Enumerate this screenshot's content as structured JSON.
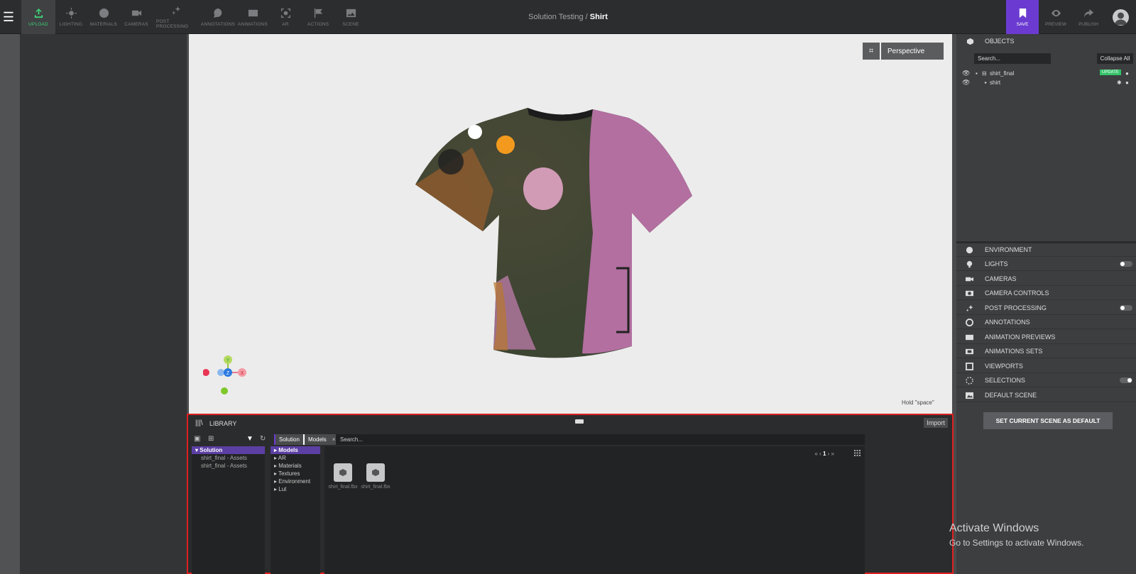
{
  "toolbar": {
    "tools": [
      {
        "label": "UPLOAD",
        "icon": "upload-icon",
        "active": true
      },
      {
        "label": "LIGHTING",
        "icon": "sun-icon"
      },
      {
        "label": "MATERIALS",
        "icon": "materials-icon"
      },
      {
        "label": "CAMERAS",
        "icon": "camera-icon"
      },
      {
        "label": "POST PROCESSING",
        "icon": "sparkle-icon"
      },
      {
        "label": "ANNOTATIONS",
        "icon": "chat-icon"
      },
      {
        "label": "ANIMATIONS",
        "icon": "film-icon"
      },
      {
        "label": "AR",
        "icon": "ar-icon"
      },
      {
        "label": "ACTIONS",
        "icon": "flag-icon"
      },
      {
        "label": "SCENE",
        "icon": "image-icon"
      }
    ],
    "right": [
      {
        "label": "SAVE",
        "icon": "bookmark-icon",
        "active": true
      },
      {
        "label": "PREVIEW",
        "icon": "eye-icon"
      },
      {
        "label": "PUBLISH",
        "icon": "share-icon"
      }
    ]
  },
  "breadcrumb": {
    "project": "Solution Testing",
    "separator": "/",
    "scene": "Shirt"
  },
  "viewport": {
    "camera_mode": "Perspective",
    "hint": "Hold \"space\"",
    "gizmo": {
      "y": "Y",
      "z": "Z",
      "x": "X"
    }
  },
  "library": {
    "title": "LIBRARY",
    "import_label": "Import",
    "tabs": [
      "Solution",
      "Models"
    ],
    "tab_close": "×",
    "search_placeholder": "Search...",
    "tree": {
      "root": "Solution",
      "children": [
        "shirt_final - Assets",
        "shirt_final - Assets"
      ]
    },
    "categories": [
      {
        "label": "Models",
        "selected": true
      },
      {
        "label": "AR"
      },
      {
        "label": "Materials"
      },
      {
        "label": "Textures"
      },
      {
        "label": "Environment"
      },
      {
        "label": "Lut"
      }
    ],
    "pager": {
      "first": "«",
      "prev": "‹",
      "page": "1",
      "next": "›",
      "last": "»"
    },
    "assets": [
      "shirt_final.fbx",
      "shirt_final.fbx"
    ]
  },
  "objects": {
    "title": "OBJECTS",
    "search_placeholder": "Search...",
    "collapse_label": "Collapse All",
    "rows": [
      {
        "name": "shirt_final",
        "badge": "UPDATE"
      },
      {
        "name": "shirt"
      }
    ]
  },
  "scene_sections": [
    {
      "label": "ENVIRONMENT",
      "icon": "globe-icon"
    },
    {
      "label": "LIGHTS",
      "icon": "bulb-icon",
      "toggle": "off"
    },
    {
      "label": "CAMERAS",
      "icon": "camera-icon"
    },
    {
      "label": "CAMERA CONTROLS",
      "icon": "camera-controls-icon"
    },
    {
      "label": "POST PROCESSING",
      "icon": "sparkle-icon",
      "toggle": "off"
    },
    {
      "label": "ANNOTATIONS",
      "icon": "chat-icon"
    },
    {
      "label": "ANIMATION PREVIEWS",
      "icon": "film-icon"
    },
    {
      "label": "ANIMATIONS SETS",
      "icon": "film-set-icon"
    },
    {
      "label": "VIEWPORTS",
      "icon": "viewport-icon"
    },
    {
      "label": "SELECTIONS",
      "icon": "selection-icon",
      "toggle": "on"
    },
    {
      "label": "DEFAULT SCENE",
      "icon": "scene-icon"
    }
  ],
  "default_scene_button": "SET CURRENT SCENE AS DEFAULT",
  "watermark": {
    "line1": "Activate Windows",
    "line2": "Go to Settings to activate Windows."
  },
  "colors": {
    "accent": "#6b3bd1",
    "active_green": "#3fd07a",
    "highlight": "#e02020",
    "badge": "#34c26a"
  }
}
